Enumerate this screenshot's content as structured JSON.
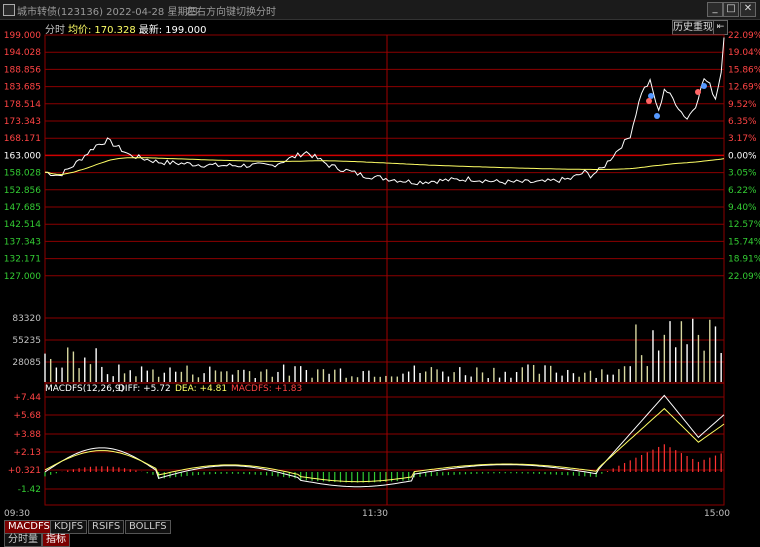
{
  "window": {
    "title": "城市转债(123136) 2022-04-28 星期四",
    "hint": "左右方向键切换分时",
    "buttons": {
      "minimize": "_",
      "maximize": "□",
      "close": "✕"
    }
  },
  "info": {
    "mode": "分时",
    "avg_label": "均价:",
    "avg_value": "170.328",
    "latest_label": "最新:",
    "latest_value": "199.000"
  },
  "controls": {
    "history_replay": "历史重现",
    "back_icon": "⇤"
  },
  "price_axis": {
    "left": [
      "199.000",
      "194.028",
      "188.856",
      "183.685",
      "178.514",
      "173.343",
      "168.171",
      "163.000",
      "158.028",
      "152.856",
      "147.685",
      "142.514",
      "137.343",
      "132.171",
      "127.000"
    ],
    "right": [
      "22.09%",
      "19.04%",
      "15.86%",
      "12.69%",
      "9.52%",
      "6.35%",
      "3.17%",
      "0.00%",
      "3.05%",
      "6.22%",
      "9.40%",
      "12.57%",
      "15.74%",
      "18.91%",
      "22.09%"
    ]
  },
  "volume_axis": [
    "83320",
    "55235",
    "28085"
  ],
  "macd": {
    "label_name": "MACDFS(12,26,9)",
    "diff_label": "DIFF: +5.72",
    "dea_label": "DEA: +4.81",
    "macdfs_label": "MACDFS: +1.83",
    "axis": [
      "+7.44",
      "+5.68",
      "+3.88",
      "+2.13",
      "+0.321",
      "-1.42"
    ]
  },
  "time_axis": [
    "09:30",
    "11:30",
    "15:00"
  ],
  "indicator_tabs": [
    "MACDFS",
    "KDJFS",
    "RSIFS",
    "BOLLFS"
  ],
  "view_tabs": [
    "分时量",
    "指标"
  ],
  "colors": {
    "price_line": "#ffffff",
    "avg_line": "#ffff66",
    "grid_red": "#8b0000",
    "up_bar": "#ff3333",
    "down_bar": "#33cc33",
    "axis_text": "#ff3333"
  }
}
